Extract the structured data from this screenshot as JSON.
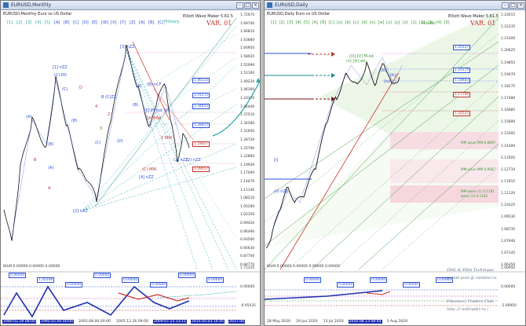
{
  "left": {
    "title": "EURUSD,Monthly",
    "symbol_header": "EURUSD,Monthly  Euro vs US Dollar",
    "indicator": "Elliott Wave Maker 5.61.5",
    "variant": "VAR. 01",
    "primary_label": "Primary",
    "top_waves": [
      "[1]",
      "[2]",
      "[3]",
      "[4]",
      "[5]",
      "[A]",
      "[B]",
      "[C]",
      "[D]",
      "[E]",
      "[W]",
      "[X]",
      "[Y]",
      "[Z]",
      "[A]",
      "[B]",
      "[C]"
    ],
    "price_axis": [
      "1.72670",
      "1.69740",
      "1.66810",
      "1.63880",
      "1.60950",
      "1.58020",
      "1.55090",
      "1.52160",
      "1.49230",
      "1.46300",
      "1.43370",
      "1.40440",
      "1.37510",
      "1.34580",
      "1.31650",
      "1.28720",
      "1.25790",
      "1.22860",
      "1.19930",
      "1.17000",
      "1.14070",
      "1.11140",
      "1.08210",
      "1.05280",
      "1.02350",
      "0.99420",
      "0.96490",
      "0.93560",
      "0.90630",
      "0.87700",
      "0.84770"
    ],
    "price_tags": [
      {
        "text": "1.46315",
        "color": "#2a4fd6"
      },
      {
        "text": "1.41571",
        "color": "#2a4fd6"
      },
      {
        "text": "1.34655",
        "color": "#2a4fd6"
      },
      {
        "text": "1.28825",
        "color": "#2a4fd6"
      },
      {
        "text": "1.18027",
        "color": "#c0312b"
      },
      {
        "text": "1.09557",
        "color": "#c0312b"
      }
    ],
    "wave_labels": [
      "[1] nZZ",
      "(C) ED",
      "[3] nZZ",
      "B (C)ZZ",
      "(B) nCF",
      "[3] IM nst 3/5",
      "[4] MW",
      "(2) nZZ",
      "(C) MW",
      "[4] nZZ",
      "2 MW",
      "[2] nZZ",
      "(A)",
      "(B)",
      "(A)",
      "(C)",
      "(B)",
      "(C)",
      "(D)",
      "(A)",
      "(B)",
      "2",
      "3",
      "4",
      "B",
      "A",
      "D",
      "(2) nZZ"
    ],
    "subwindow": "WLM 0.00000 0.00000 0.00000",
    "sub_tags": [
      "0.00000",
      "1.20106",
      "0.00000",
      "0.00000",
      "0.00000",
      "0.00000",
      "0.00000",
      "0.00000"
    ],
    "sub_axis": [
      "1.71335",
      "0.00000",
      "-0.95435"
    ],
    "time_axis": [
      {
        "text": "1980.02.29 08:00",
        "hl": true
      },
      {
        "text": "1995.02.00 00:00",
        "hl": true
      },
      {
        "text": "2003.08.00 00:00",
        "hl": false
      },
      {
        "text": "2005.12.26 09:00",
        "hl": false
      },
      {
        "text": "2009.07.15 13:11",
        "hl": true
      },
      {
        "text": "2014.05.03 14:45",
        "hl": true
      },
      {
        "text": "2017.00",
        "hl": true
      }
    ]
  },
  "right": {
    "title": "EURUSD,Daily",
    "symbol_header": "EURUSD,Daily  Euro vs US Dollar",
    "indicator": "Elliott Wave Maker 5.61.5",
    "variant": "VAR. 01",
    "minute_label": "Minute",
    "top_waves": [
      "[1]",
      "[2]",
      "[3]",
      "[4]",
      "[5]",
      "[A]",
      "[B]",
      "[C]",
      "[a]",
      "[b]",
      "[c]",
      "[d]",
      "[e]",
      "[w]",
      "[x]",
      "[y]",
      "[z]",
      "[1]",
      "[2]",
      "[3]",
      "[4]",
      "[5]"
    ],
    "price_axis": [
      "1.23015",
      "1.22235",
      "1.21400",
      "1.20625",
      "1.19855",
      "1.19070",
      "1.18275",
      "1.17480",
      "1.16685",
      "1.15890",
      "1.15095",
      "1.14300",
      "1.13505",
      "1.12710",
      "1.11915",
      "1.11120",
      "1.10325",
      "1.09530",
      "1.08735",
      "1.07940",
      "1.07145",
      "1.06350"
    ],
    "price_tags": [
      {
        "text": "1.20227",
        "color": "#2a4fd6"
      },
      {
        "text": "1.19370",
        "color": "#2a4fd6"
      },
      {
        "text": "1.18483",
        "color": "#2a4fd6"
      },
      {
        "text": "1.17740",
        "color": "#c0312b"
      },
      {
        "text": "1.16521",
        "color": "#c0312b"
      }
    ],
    "zone_labels": [
      "MM wave MM.0.8897",
      "MM wave MM.0.9087",
      "MM wave (1) 0.1181",
      "wave (1) 0.1181"
    ],
    "wave_labels": [
      "[iii] [V] M.ed",
      "(v) [iii] ed",
      "[i]",
      "(ii) nZZ",
      "(iv)",
      "(b)",
      "(b)"
    ],
    "subwindow": "WLM 0.00000 0.00000 0.00000 0.00000",
    "sub_tags": [
      "0.00000",
      "0.00000",
      "0.00000",
      "0.00000",
      "0.00000"
    ],
    "sub_axis": [
      "1.00950",
      "0.00000",
      "-1.00950"
    ],
    "time_axis": [
      {
        "text": "28 May 2020",
        "hl": false
      },
      {
        "text": "19 Jun 2020",
        "hl": false
      },
      {
        "text": "13 Jul 2020",
        "hl": false
      },
      {
        "text": "2020.08.13 08:44",
        "hl": true
      },
      {
        "text": "3 Aug 2020",
        "hl": false
      }
    ],
    "credits": [
      "DML & EWA Technique",
      "putnik-post @ rambler.ru",
      "Fibonacci  Traders  Club",
      "http :// redtrader.ru /"
    ]
  }
}
